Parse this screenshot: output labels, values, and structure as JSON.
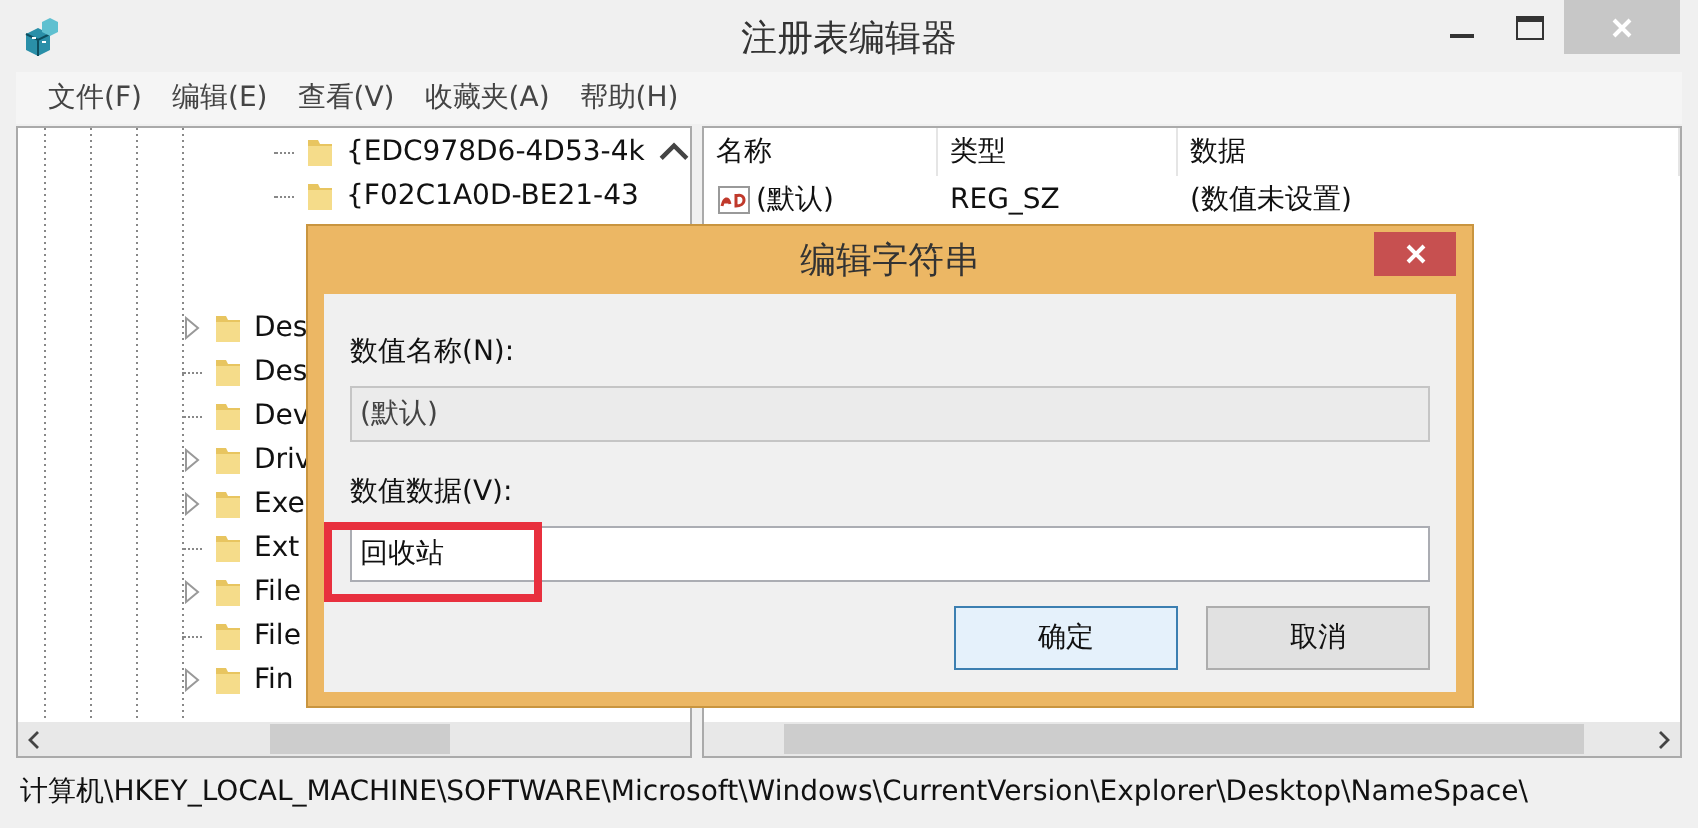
{
  "window": {
    "title": "注册表编辑器"
  },
  "menu": [
    "文件(F)",
    "编辑(E)",
    "查看(V)",
    "收藏夹(A)",
    "帮助(H)"
  ],
  "tree": {
    "nested_items": [
      {
        "label": "{EDC978D6-4D53-4k",
        "has_children": false
      },
      {
        "label": "{F02C1A0D-BE21-43",
        "has_children": false
      }
    ],
    "items": [
      {
        "label": "Des",
        "has_children": true
      },
      {
        "label": "Des",
        "has_children": false
      },
      {
        "label": "Dev",
        "has_children": false
      },
      {
        "label": "Driv",
        "has_children": true
      },
      {
        "label": "Exe",
        "has_children": true
      },
      {
        "label": "Ext",
        "has_children": false
      },
      {
        "label": "File",
        "has_children": true
      },
      {
        "label": "File",
        "has_children": false
      },
      {
        "label": "Fin",
        "has_children": true
      }
    ]
  },
  "list": {
    "columns": [
      "名称",
      "类型",
      "数据"
    ],
    "rows": [
      {
        "name": "(默认)",
        "type": "REG_SZ",
        "data": "(数值未设置)"
      }
    ]
  },
  "dialog": {
    "title": "编辑字符串",
    "fields": [
      {
        "label": "数值名称(N):",
        "value": "(默认)",
        "disabled": true
      },
      {
        "label": "数值数据(V):",
        "value": "回收站",
        "disabled": false
      }
    ],
    "buttons": [
      {
        "label": "确定",
        "default": true
      },
      {
        "label": "取消",
        "default": false
      }
    ]
  },
  "status_bar": "计算机\\HKEY_LOCAL_MACHINE\\SOFTWARE\\Microsoft\\Windows\\CurrentVersion\\Explorer\\Desktop\\NameSpace\\"
}
